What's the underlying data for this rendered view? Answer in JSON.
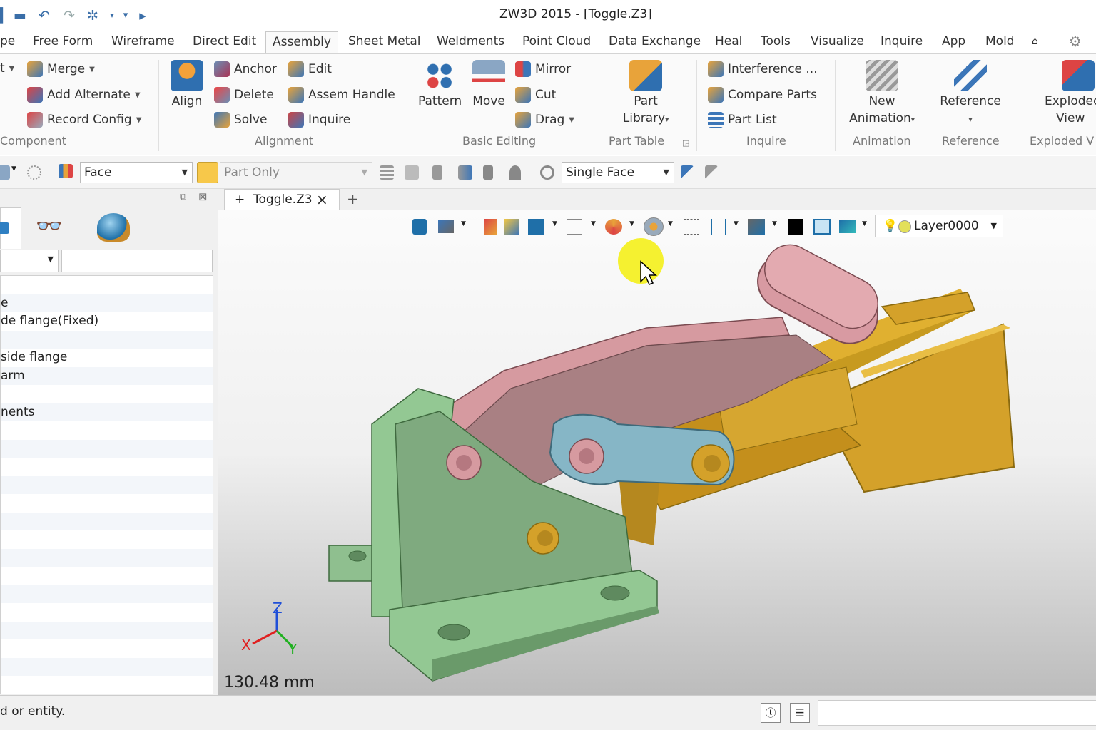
{
  "window": {
    "title": "ZW3D 2015 - [Toggle.Z3]"
  },
  "quick_access": [
    "save-icon",
    "print-icon",
    "undo-icon",
    "redo-icon",
    "regen-icon",
    "customize-icon",
    "run-icon"
  ],
  "tabs": [
    {
      "label": "pe"
    },
    {
      "label": "Free Form"
    },
    {
      "label": "Wireframe"
    },
    {
      "label": "Direct Edit"
    },
    {
      "label": "Assembly",
      "active": true
    },
    {
      "label": "Sheet Metal"
    },
    {
      "label": "Weldments"
    },
    {
      "label": "Point Cloud"
    },
    {
      "label": "Data Exchange"
    },
    {
      "label": "Heal"
    },
    {
      "label": "Tools"
    },
    {
      "label": "Visualize"
    },
    {
      "label": "Inquire"
    },
    {
      "label": "App"
    },
    {
      "label": "Mold"
    }
  ],
  "ribbon": {
    "component": {
      "group": "Component",
      "items": [
        {
          "label": "t"
        },
        {
          "label": "Merge"
        },
        {
          "label": "Add Alternate"
        },
        {
          "label": "Record Config"
        }
      ]
    },
    "alignment": {
      "group": "Alignment",
      "align": "Align",
      "items": [
        {
          "label": "Anchor"
        },
        {
          "label": "Delete"
        },
        {
          "label": "Solve"
        },
        {
          "label": "Edit"
        },
        {
          "label": "Assem Handle"
        },
        {
          "label": "Inquire"
        }
      ]
    },
    "basic_editing": {
      "group": "Basic Editing",
      "pattern": "Pattern",
      "move": "Move",
      "items": [
        {
          "label": "Mirror"
        },
        {
          "label": "Cut"
        },
        {
          "label": "Drag"
        }
      ]
    },
    "part_table": {
      "group": "Part Table",
      "part": "Part",
      "library": "Library"
    },
    "inquire": {
      "group": "Inquire",
      "items": [
        {
          "label": "Interference ..."
        },
        {
          "label": "Compare Parts"
        },
        {
          "label": "Part List"
        }
      ]
    },
    "animation": {
      "group": "Animation",
      "new": "New",
      "animation": "Animation"
    },
    "reference": {
      "group": "Reference",
      "label": "Reference"
    },
    "exploded": {
      "group": "Exploded V",
      "line1": "Explodec",
      "line2": "View"
    }
  },
  "toolbar": {
    "filter": "Face",
    "scope": "Part Only",
    "pick_mode": "Single Face"
  },
  "doc_tab": {
    "label": "Toggle.Z3",
    "add": "+",
    "close": "×",
    "new_tab": "+"
  },
  "view_toolbar": {
    "layer": "Layer0000"
  },
  "tree": {
    "rows": [
      {
        "text": ""
      },
      {
        "text": "e"
      },
      {
        "text": "de flange(Fixed)"
      },
      {
        "text": ""
      },
      {
        "text": "side flange"
      },
      {
        "text": "arm"
      },
      {
        "text": ""
      },
      {
        "text": "nents"
      },
      {
        "text": ""
      },
      {
        "text": ""
      },
      {
        "text": ""
      },
      {
        "text": ""
      },
      {
        "text": ""
      },
      {
        "text": ""
      },
      {
        "text": ""
      },
      {
        "text": ""
      },
      {
        "text": ""
      },
      {
        "text": ""
      },
      {
        "text": ""
      },
      {
        "text": ""
      },
      {
        "text": ""
      },
      {
        "text": ""
      },
      {
        "text": ""
      }
    ]
  },
  "viewport": {
    "scale_readout": "130.48 mm",
    "triad": {
      "x": "X",
      "y": "Y",
      "z": "Z"
    },
    "colors": {
      "base": "#93c893",
      "handle": "#d69aa0",
      "link": "#86b6c6",
      "body": "#d4a12a"
    }
  },
  "status": {
    "prompt": "d or entity."
  }
}
